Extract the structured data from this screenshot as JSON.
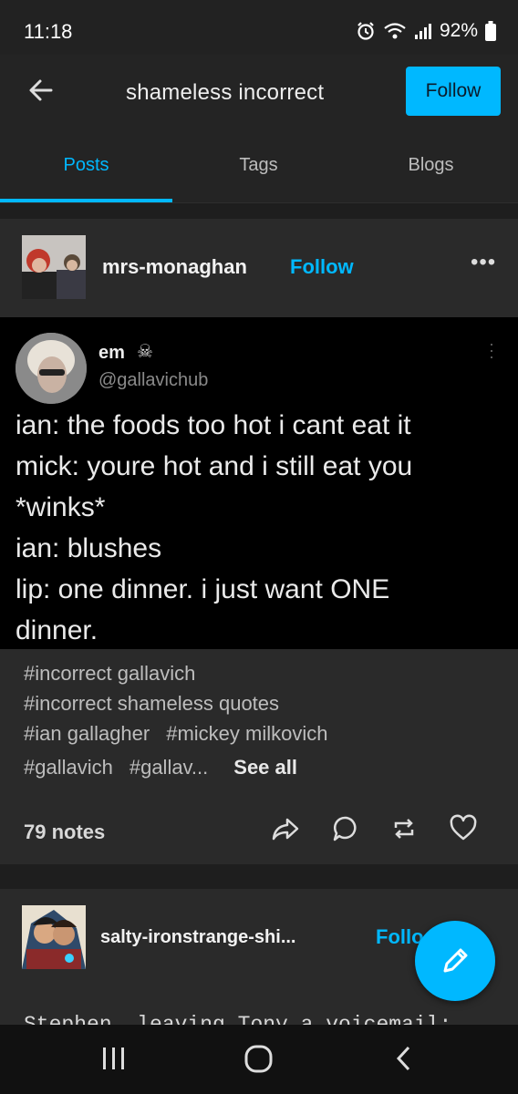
{
  "status_bar": {
    "time": "11:18",
    "battery": "92%"
  },
  "header": {
    "title": "shameless incorrect",
    "follow_label": "Follow"
  },
  "tabs": [
    {
      "label": "Posts",
      "active": true
    },
    {
      "label": "Tags",
      "active": false
    },
    {
      "label": "Blogs",
      "active": false
    }
  ],
  "post": {
    "blog_name": "mrs-monaghan",
    "follow_label": "Follow",
    "more": "•••",
    "tweet": {
      "name": "em",
      "emoji": "☠",
      "handle": "@gallavichub",
      "lines": [
        "ian: the foods too hot i cant eat it",
        "mick: youre hot and i still eat you",
        "*winks*",
        "ian: blushes",
        "lip: one dinner. i just want ONE",
        "dinner."
      ]
    },
    "tags": {
      "row1": [
        "#incorrect gallavich"
      ],
      "row2": [
        "#incorrect shameless quotes"
      ],
      "row3": [
        "#ian gallagher",
        "#mickey milkovich"
      ],
      "row4": [
        "#gallavich",
        "#gallav..."
      ],
      "see_all": "See all"
    },
    "notes": "79 notes"
  },
  "post2": {
    "blog_name": "salty-ironstrange-shi...",
    "follow_label": "Follo",
    "text": "Stephen, leaving Tony a voicemail:"
  },
  "colors": {
    "accent": "#00b8ff",
    "background": "#1e1e1e",
    "card": "#2a2a2a"
  }
}
